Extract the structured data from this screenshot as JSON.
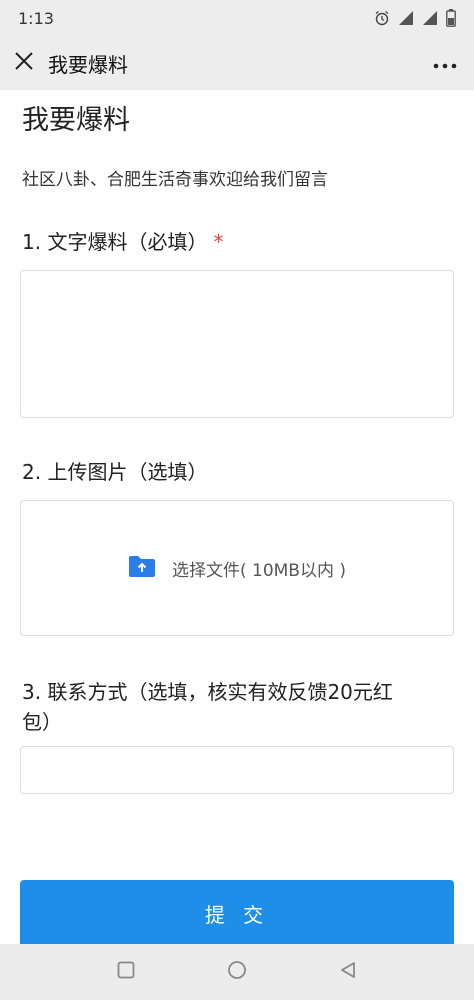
{
  "status_bar": {
    "time": "1:13"
  },
  "title_bar": {
    "title": "我要爆料"
  },
  "page": {
    "title": "我要爆料",
    "subtitle": "社区八卦、合肥生活奇事欢迎给我们留言"
  },
  "questions": [
    {
      "label": "1. 文字爆料（必填）",
      "required_mark": "*"
    },
    {
      "label": "2. 上传图片（选填）",
      "upload_text": "选择文件( 10MB以内 )"
    },
    {
      "label_line1": "3. 联系方式（选填，核实有效反馈20元红",
      "label_line2": "包）"
    }
  ],
  "submit": {
    "label": "提 交"
  },
  "colors": {
    "accent": "#1e8ee8",
    "required": "#e64340",
    "upload_icon": "#2b7de9"
  },
  "icons": {
    "status": [
      "alarm-icon",
      "4g-signal-icon",
      "signal-icon",
      "battery-icon"
    ],
    "title_bar": [
      "close-icon",
      "more-icon"
    ],
    "upload": "folder-upload-icon",
    "nav": [
      "recent-apps-icon",
      "home-icon",
      "back-icon"
    ]
  }
}
